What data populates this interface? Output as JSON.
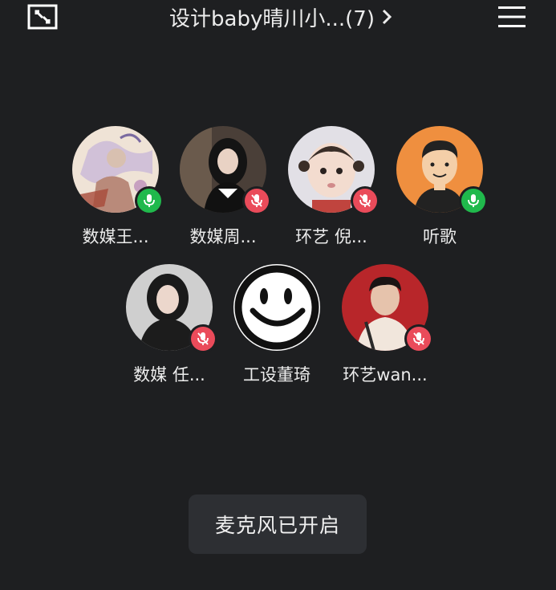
{
  "header": {
    "title": "设计baby晴川小...(7)",
    "minimize_icon": "minimize-window-icon",
    "chevron_icon": "chevron-right-icon",
    "menu_icon": "hamburger-menu-icon"
  },
  "members": [
    {
      "name": "数媒王...",
      "mic": "on",
      "avatar": "illustration-avatar"
    },
    {
      "name": "数媒周...",
      "mic": "off",
      "avatar": "girl-dark-hair-avatar"
    },
    {
      "name": "环艺 倪...",
      "mic": "off",
      "avatar": "toddler-avatar"
    },
    {
      "name": "听歌",
      "mic": "on",
      "avatar": "cartoon-man-avatar"
    },
    {
      "name": "数媒 任...",
      "mic": "off",
      "avatar": "woman-portrait-avatar"
    },
    {
      "name": "工设董琦",
      "mic": "none",
      "avatar": "smiley-face-avatar"
    },
    {
      "name": "环艺wan...",
      "mic": "off",
      "avatar": "man-red-background-avatar"
    }
  ],
  "toast": {
    "text": "麦克风已开启"
  },
  "colors": {
    "background": "#1e1f21",
    "mic_on": "#20b94c",
    "mic_off": "#ea4b5a",
    "toast_bg": "#2d2f33"
  }
}
